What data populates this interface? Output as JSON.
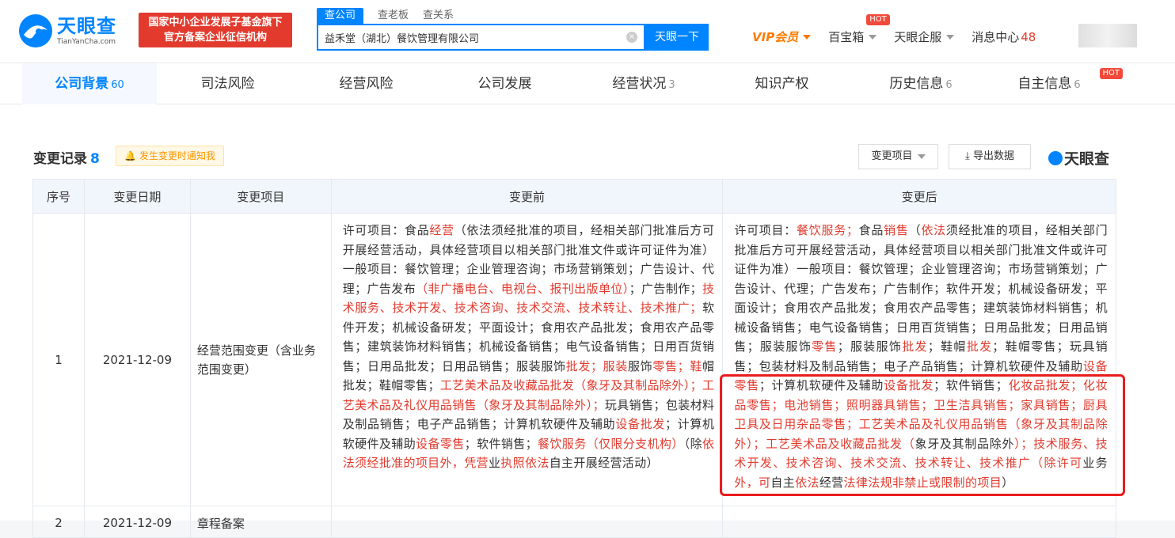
{
  "header": {
    "logo_cn": "天眼查",
    "logo_en": "TianYanCha.com",
    "fund_line1": "国家中小企业发展子基金旗下",
    "fund_line2": "官方备案企业征信机构",
    "search_tabs": [
      "查公司",
      "查老板",
      "查关系"
    ],
    "search_value": "益禾堂（湖北）餐饮管理有限公司",
    "search_button": "天眼一下",
    "nav": {
      "vip": "VIP会员",
      "treasure": "百宝箱",
      "hot": "HOT",
      "enterprise": "天眼企服",
      "messages": "消息中心",
      "message_count": "48"
    }
  },
  "tabs": [
    {
      "label": "公司背景",
      "count": "60"
    },
    {
      "label": "司法风险",
      "count": ""
    },
    {
      "label": "经营风险",
      "count": ""
    },
    {
      "label": "公司发展",
      "count": ""
    },
    {
      "label": "经营状况",
      "count": "3"
    },
    {
      "label": "知识产权",
      "count": ""
    },
    {
      "label": "历史信息",
      "count": "6"
    },
    {
      "label": "自主信息",
      "count": "6",
      "hot": "HOT"
    }
  ],
  "section": {
    "title": "变更记录",
    "count": "8",
    "notify": "发生变更时通知我",
    "filter": "变更项目",
    "export": "导出数据",
    "brand": "天眼查"
  },
  "table": {
    "headers": [
      "序号",
      "变更日期",
      "变更项目",
      "变更前",
      "变更后"
    ],
    "rows": [
      {
        "index": "1",
        "date": "2021-12-09",
        "item": "经营范围变更（含业务范围变更）",
        "before": "许可项目：食品经营（依法须经批准的项目，经相关部门批准后方可开展经营活动，具体经营项目以相关部门批准文件或许可证件为准）一般项目：餐饮管理；企业管理咨询；市场营销策划；广告设计、代理；广告发布（非广播电台、电视台、报刊出版单位）；广告制作；技术服务、技术开发、技术咨询、技术交流、技术转让、技术推广；软件开发；机械设备研发；平面设计；食用农产品批发；食用农产品零售；建筑装饰材料销售；机械设备销售；电气设备销售；日用百货销售；日用品批发；日用品销售；服装服饰批发；服装服饰零售；鞋帽批发；鞋帽零售；工艺美术品及收藏品批发（象牙及其制品除外）；工艺美术品及礼仪用品销售（象牙及其制品除外）；玩具销售；包装材料及制品销售；电子产品销售；计算机软硬件及辅助设备批发；计算机软硬件及辅助设备零售；软件销售；餐饮服务（仅限分支机构）（除依法须经批准的项目外，凭营业执照依法自主开展经营活动）",
        "after": "许可项目：餐饮服务；食品销售（依法须经批准的项目，经相关部门批准后方可开展经营活动，具体经营项目以相关部门批准文件或许可证件为准）一般项目：餐饮管理；企业管理咨询；市场营销策划；广告设计、代理；广告发布；广告制作；软件开发；机械设备研发；平面设计；食用农产品批发；食用农产品零售；建筑装饰材料销售；机械设备销售；电气设备销售；日用百货销售；日用品批发；日用品销售；服装服饰零售；服装服饰批发；鞋帽批发；鞋帽零售；玩具销售；包装材料及制品销售；电子产品销售；计算机软硬件及辅助设备零售；计算机软硬件及辅助设备批发；软件销售；化妆品批发；化妆品零售；电池销售；照明器具销售；卫生洁具销售；家具销售；厨具卫具及日用杂品零售；工艺美术品及礼仪用品销售（象牙及其制品除外）；工艺美术品及收藏品批发（象牙及其制品除外）；技术服务、技术开发、技术咨询、技术交流、技术转让、技术推广（除许可业务外，可自主依法经营法律法规非禁止或限制的项目）"
      },
      {
        "index": "2",
        "date": "2021-12-09",
        "item": "章程备案"
      }
    ]
  },
  "colors": {
    "brand_blue": "#0084ff",
    "highlight_red": "#e23b2e",
    "annotation_box": "#ea1c1c"
  }
}
